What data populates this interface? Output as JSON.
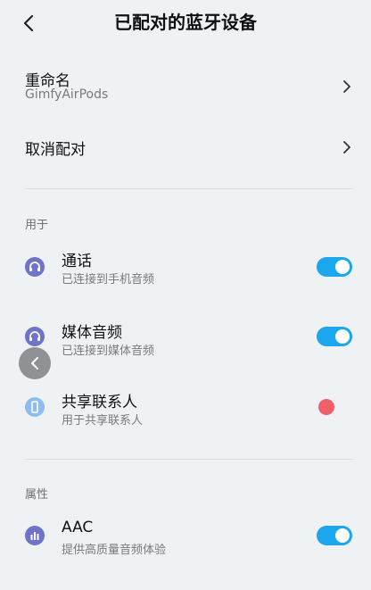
{
  "header": {
    "title": "已配对的蓝牙设备"
  },
  "rename": {
    "title": "重命名",
    "value": "GimfyAirPods"
  },
  "unpair": {
    "title": "取消配对"
  },
  "sections": {
    "used_for": "用于",
    "properties": "属性"
  },
  "items": [
    {
      "title": "通话",
      "subtitle": "已连接到手机音频",
      "icon": "headset-icon",
      "enabled": true
    },
    {
      "title": "媒体音频",
      "subtitle": "已连接到媒体音频",
      "icon": "headphones-icon",
      "enabled": true
    },
    {
      "title": "共享联系人",
      "subtitle": "用于共享联系人",
      "icon": "phone-icon",
      "enabled": false
    }
  ],
  "aac": {
    "title": "AAC",
    "subtitle": "提供高质量音频体验",
    "icon": "bars-icon",
    "enabled": true
  },
  "colors": {
    "accent": "#1aa7ee",
    "icon_purple": "#6f73c9",
    "icon_lightblue": "#8dbdf0",
    "off_dot": "#f0606a"
  }
}
